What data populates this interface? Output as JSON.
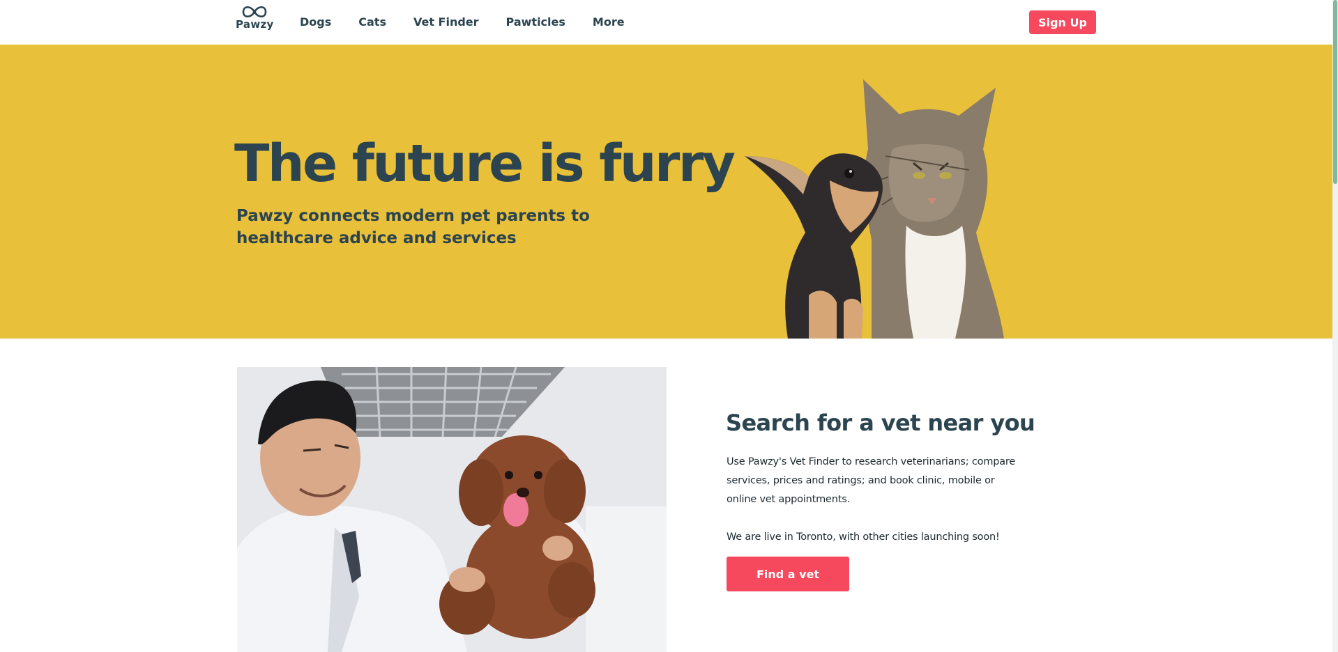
{
  "header": {
    "logo_text": "Pawzy",
    "nav": [
      {
        "label": "Dogs"
      },
      {
        "label": "Cats"
      },
      {
        "label": "Vet Finder"
      },
      {
        "label": "Pawticles"
      },
      {
        "label": "More"
      }
    ],
    "signup_label": "Sign Up"
  },
  "hero": {
    "title": "The future is furry",
    "subtitle": "Pawzy connects modern pet parents to healthcare advice and services",
    "image": "dog-and-cat-photo"
  },
  "vet_section": {
    "image": "vet-with-poodle-photo",
    "title": "Search for a vet near you",
    "paragraph1": "Use Pawzy's Vet Finder to research veterinarians; compare services, prices and ratings; and book clinic, mobile or online vet appointments.",
    "paragraph2": "We are live in Toronto, with other cities launching soon!",
    "button_label": "Find a vet"
  },
  "colors": {
    "brand_dark": "#2b4450",
    "accent_red": "#f6495e",
    "hero_yellow": "#e8c03a"
  }
}
